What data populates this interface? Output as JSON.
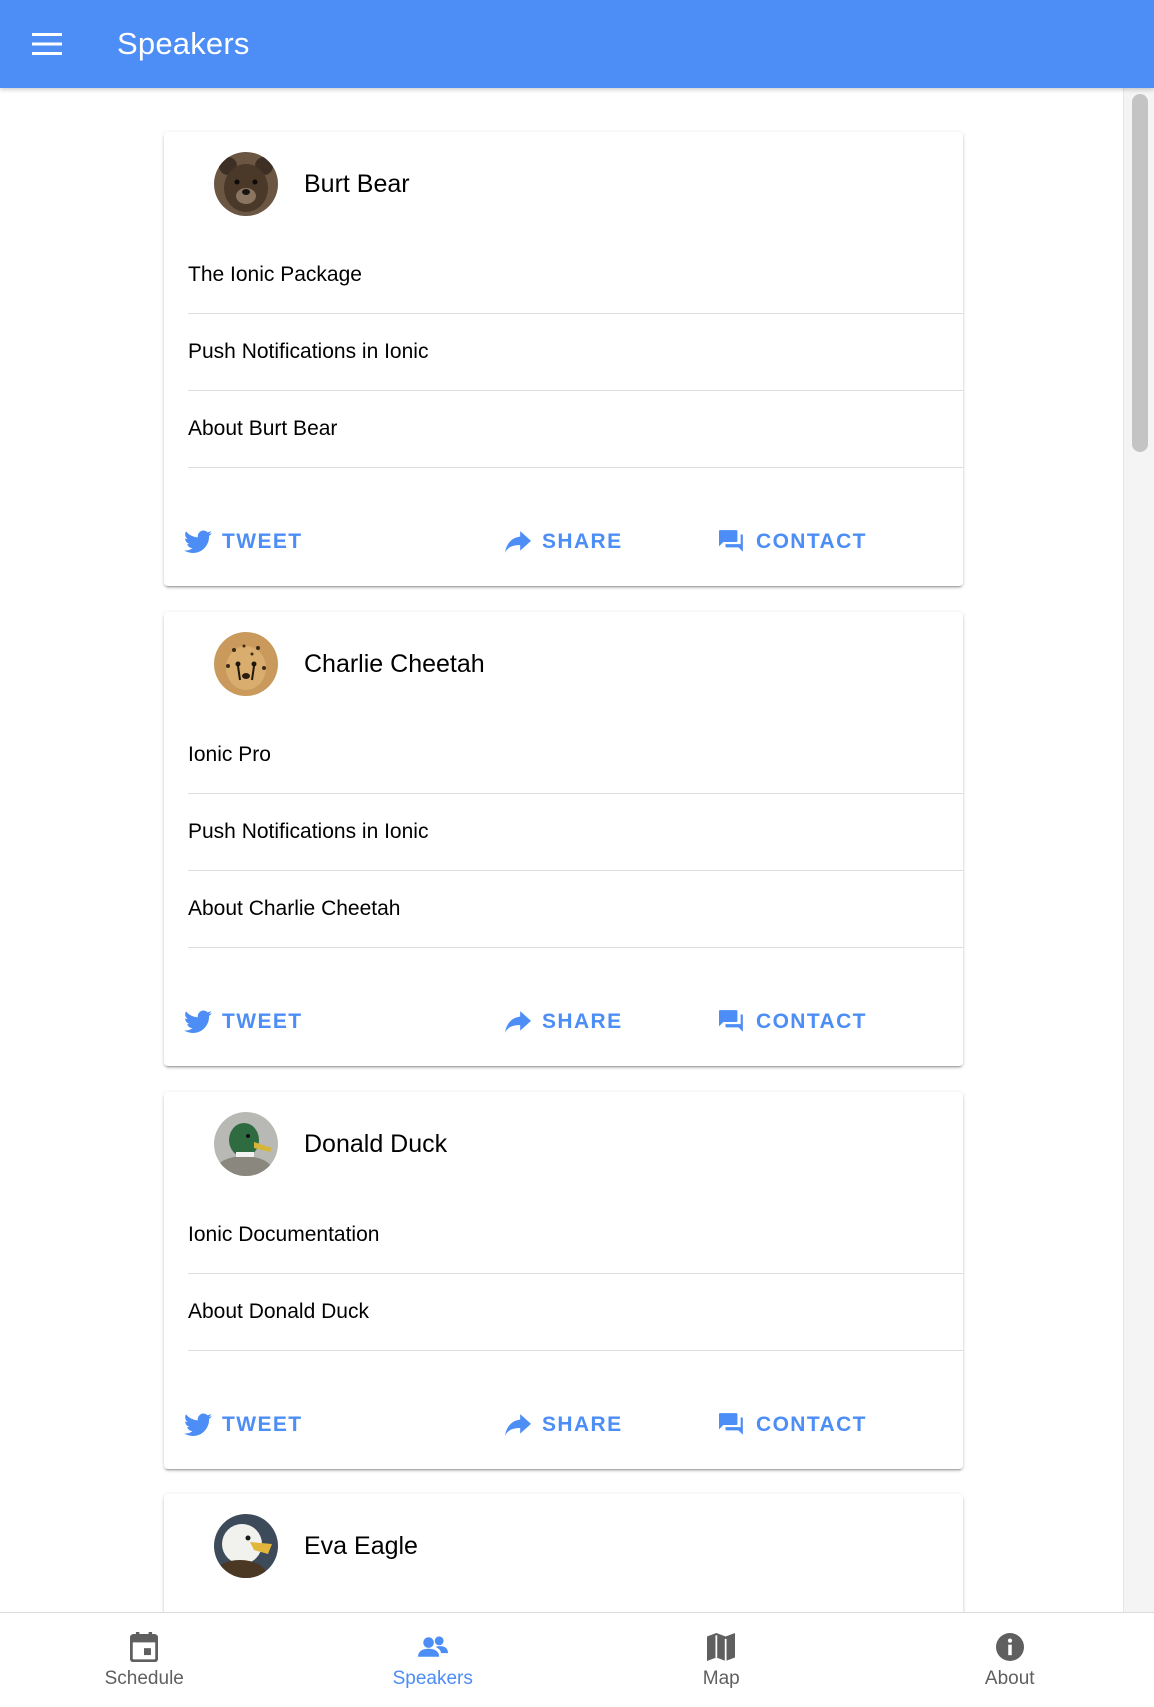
{
  "header": {
    "title": "Speakers",
    "menu_icon": "menu-icon"
  },
  "speakers": [
    {
      "name": "Burt Bear",
      "avatar": "bear-avatar",
      "items": [
        "The Ionic Package",
        "Push Notifications in Ionic",
        "About Burt Bear"
      ],
      "actions": {
        "tweet": "TWEET",
        "share": "SHARE",
        "contact": "CONTACT"
      }
    },
    {
      "name": "Charlie Cheetah",
      "avatar": "cheetah-avatar",
      "items": [
        "Ionic Pro",
        "Push Notifications in Ionic",
        "About Charlie Cheetah"
      ],
      "actions": {
        "tweet": "TWEET",
        "share": "SHARE",
        "contact": "CONTACT"
      }
    },
    {
      "name": "Donald Duck",
      "avatar": "duck-avatar",
      "items": [
        "Ionic Documentation",
        "About Donald Duck"
      ],
      "actions": {
        "tweet": "TWEET",
        "share": "SHARE",
        "contact": "CONTACT"
      }
    },
    {
      "name": "Eva Eagle",
      "avatar": "eagle-avatar",
      "items": [],
      "actions": {}
    }
  ],
  "tabs": [
    {
      "label": "Schedule",
      "icon": "calendar-icon",
      "active": false
    },
    {
      "label": "Speakers",
      "icon": "people-icon",
      "active": true
    },
    {
      "label": "Map",
      "icon": "map-icon",
      "active": false
    },
    {
      "label": "About",
      "icon": "info-icon",
      "active": false
    }
  ],
  "colors": {
    "primary": "#4c8df6",
    "tab_inactive": "#5f5f5f",
    "divider": "#dedede"
  }
}
